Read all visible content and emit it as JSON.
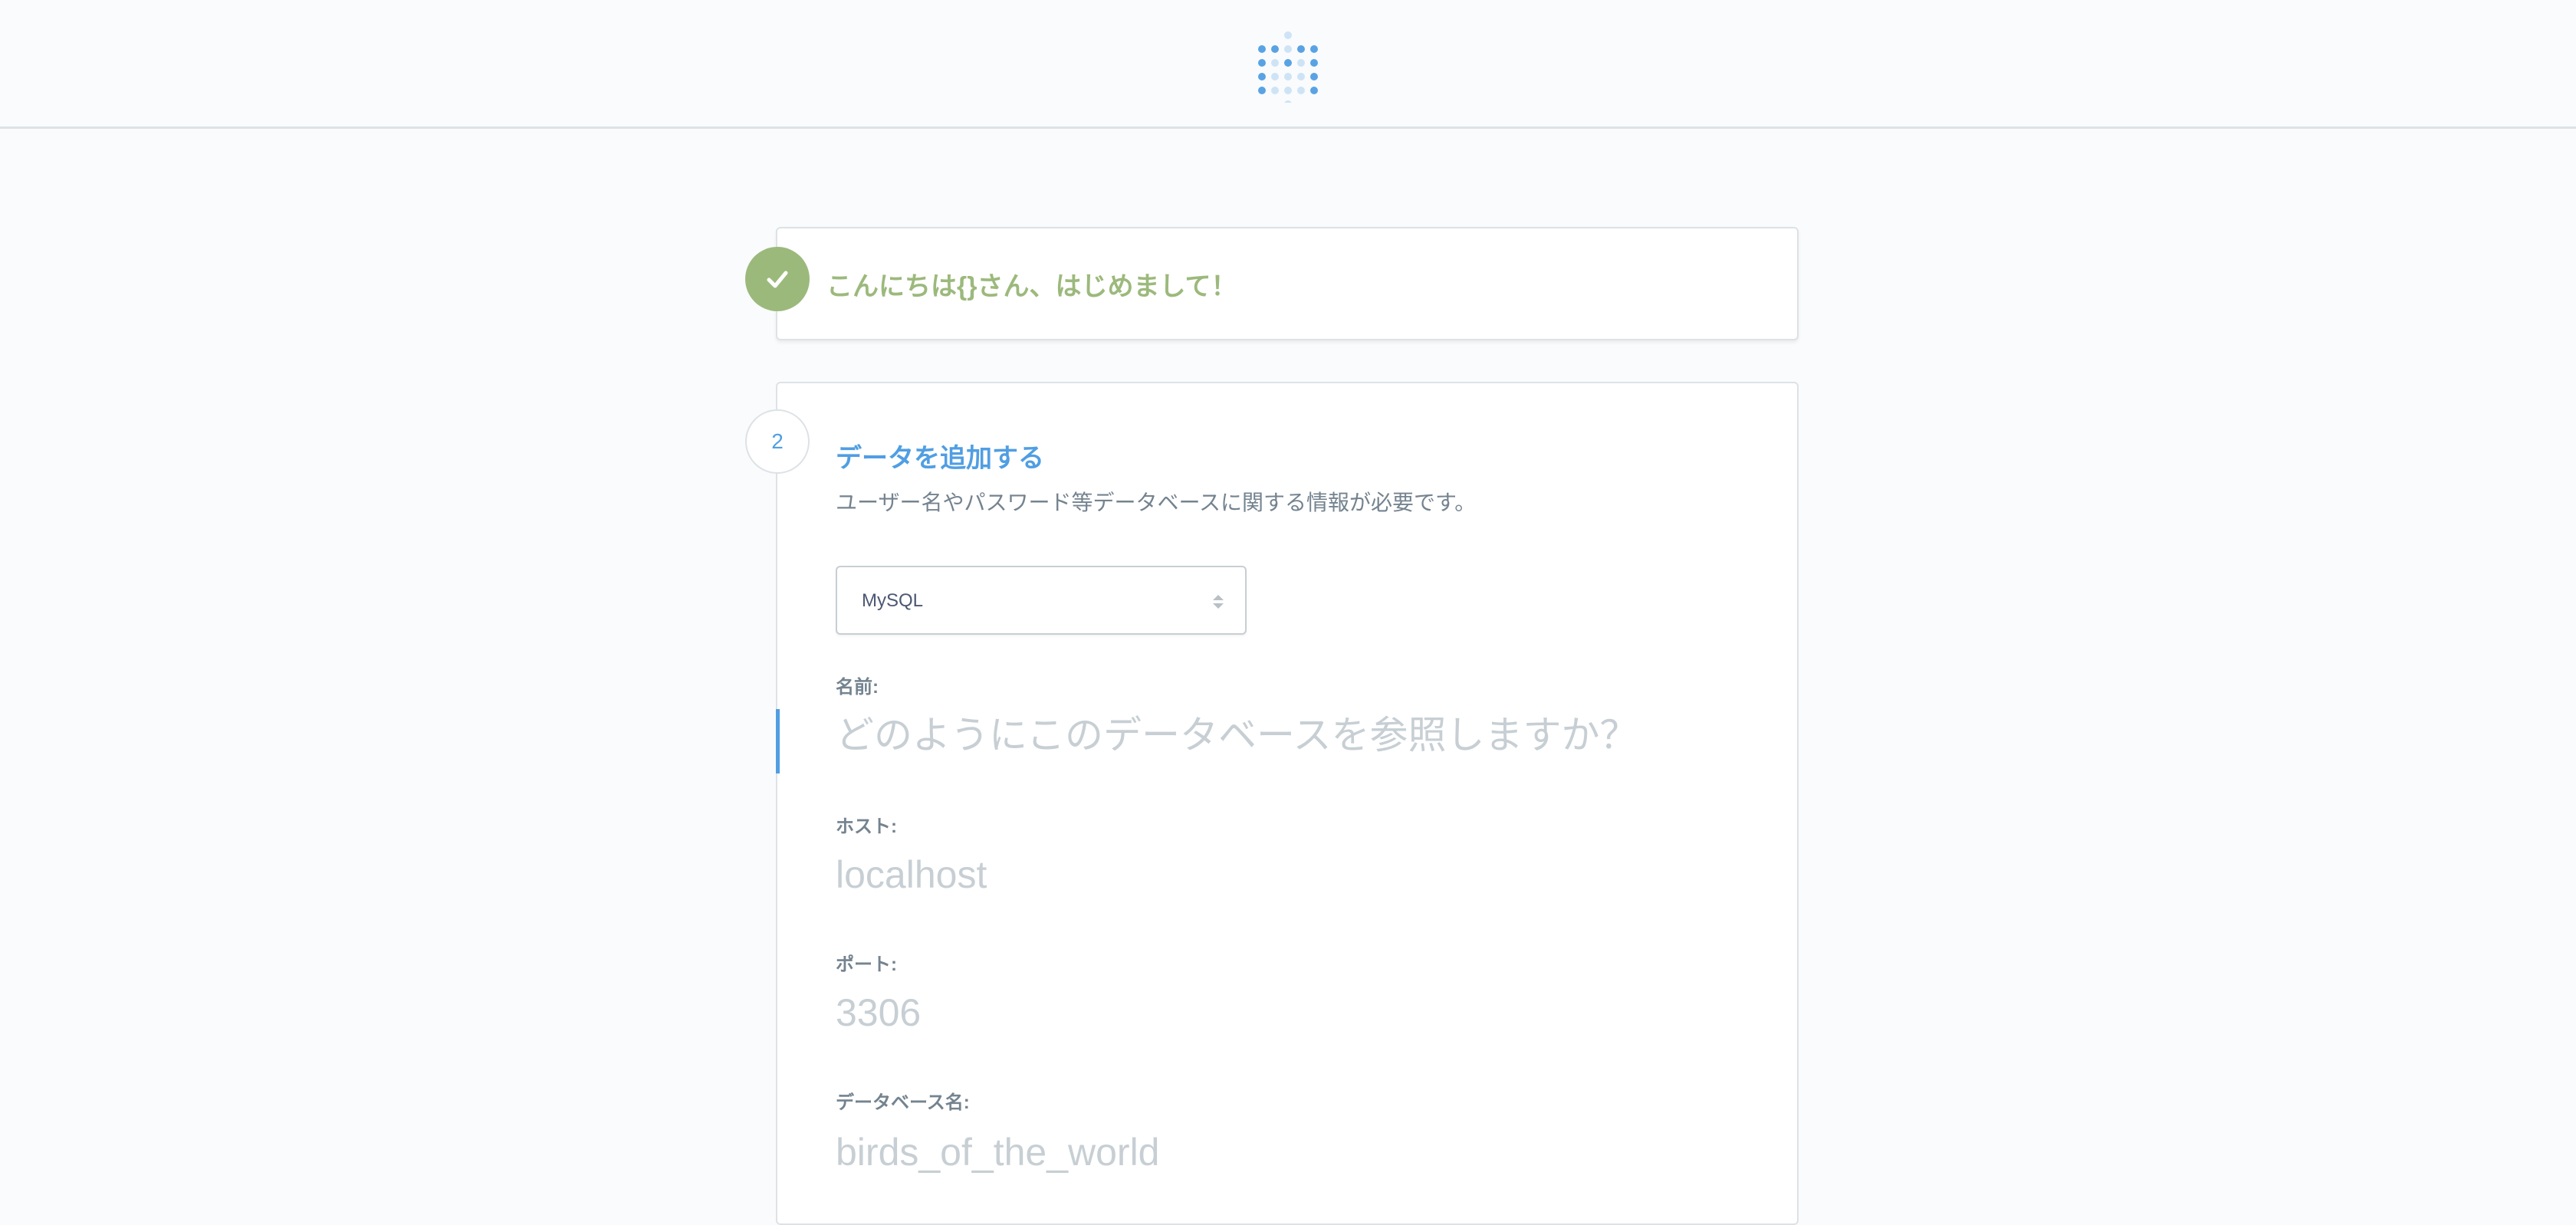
{
  "header": {
    "logo": "metabase-logo"
  },
  "step1": {
    "icon": "check-icon",
    "title": "こんにちは{}さん、はじめまして！",
    "color": "#9cb97c"
  },
  "step2": {
    "number": "2",
    "title": "データを追加する",
    "description": "ユーザー名やパスワード等データベースに関する情報が必要です。",
    "accent": "#509ee3",
    "database_type": {
      "selected": "MySQL",
      "icon": "sort-arrows-icon"
    },
    "fields": {
      "name": {
        "label": "名前:",
        "value": "",
        "placeholder": "どのようにこのデータベースを参照しますか？"
      },
      "host": {
        "label": "ホスト:",
        "value": "",
        "placeholder": "localhost"
      },
      "port": {
        "label": "ポート:",
        "value": "",
        "placeholder": "3306"
      },
      "dbname": {
        "label": "データベース名:",
        "value": "",
        "placeholder": "birds_of_the_world"
      }
    }
  }
}
